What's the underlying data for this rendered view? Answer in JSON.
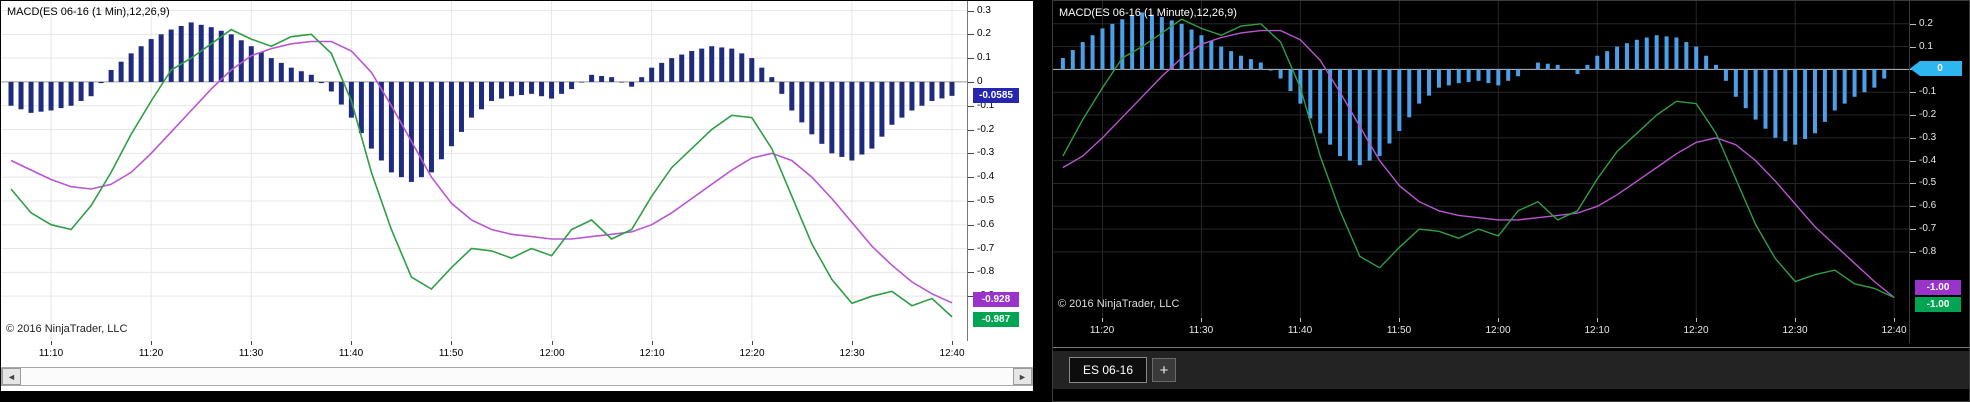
{
  "chart_data": [
    {
      "type": "bar",
      "subtype": "macd-indicator",
      "title": "MACD(ES 06-16 (1 Min),12,26,9)",
      "copyright": "© 2016 NinjaTrader, LLC",
      "theme": "light",
      "x": [
        "11:06",
        "11:08",
        "11:10",
        "11:12",
        "11:14",
        "11:16",
        "11:18",
        "11:20",
        "11:22",
        "11:24",
        "11:26",
        "11:28",
        "11:30",
        "11:32",
        "11:34",
        "11:36",
        "11:38",
        "11:40",
        "11:42",
        "11:44",
        "11:46",
        "11:48",
        "11:50",
        "11:52",
        "11:54",
        "11:56",
        "11:58",
        "12:00",
        "12:02",
        "12:04",
        "12:06",
        "12:08",
        "12:10",
        "12:12",
        "12:14",
        "12:16",
        "12:18",
        "12:20",
        "12:22",
        "12:24",
        "12:26",
        "12:28",
        "12:30",
        "12:32",
        "12:34",
        "12:36",
        "12:38",
        "12:40"
      ],
      "histogram": [
        -0.1,
        -0.13,
        -0.12,
        -0.1,
        -0.06,
        0.05,
        0.12,
        0.18,
        0.22,
        0.25,
        0.23,
        0.2,
        0.15,
        0.1,
        0.06,
        0.03,
        -0.04,
        -0.15,
        -0.28,
        -0.38,
        -0.42,
        -0.38,
        -0.27,
        -0.15,
        -0.08,
        -0.06,
        -0.05,
        -0.07,
        -0.03,
        0.03,
        0.02,
        -0.02,
        0.06,
        0.1,
        0.13,
        0.15,
        0.14,
        0.1,
        0.02,
        -0.12,
        -0.22,
        -0.3,
        -0.33,
        -0.28,
        -0.18,
        -0.12,
        -0.08,
        -0.0585
      ],
      "histogram_color": "#1f2b7d",
      "series": [
        {
          "name": "MACD",
          "color": "#2f9e44",
          "values": [
            -0.45,
            -0.55,
            -0.6,
            -0.62,
            -0.52,
            -0.38,
            -0.22,
            -0.08,
            0.05,
            0.1,
            0.16,
            0.22,
            0.18,
            0.15,
            0.19,
            0.2,
            0.12,
            -0.08,
            -0.38,
            -0.62,
            -0.82,
            -0.87,
            -0.78,
            -0.7,
            -0.71,
            -0.74,
            -0.7,
            -0.73,
            -0.62,
            -0.58,
            -0.66,
            -0.62,
            -0.48,
            -0.36,
            -0.28,
            -0.2,
            -0.14,
            -0.15,
            -0.28,
            -0.48,
            -0.68,
            -0.83,
            -0.93,
            -0.9,
            -0.88,
            -0.94,
            -0.91,
            -0.987
          ]
        },
        {
          "name": "Avg",
          "color": "#ba55d3",
          "values": [
            -0.33,
            -0.37,
            -0.41,
            -0.44,
            -0.45,
            -0.43,
            -0.38,
            -0.3,
            -0.21,
            -0.12,
            -0.03,
            0.05,
            0.11,
            0.14,
            0.16,
            0.17,
            0.17,
            0.13,
            0.04,
            -0.1,
            -0.25,
            -0.4,
            -0.51,
            -0.58,
            -0.62,
            -0.64,
            -0.65,
            -0.66,
            -0.66,
            -0.65,
            -0.64,
            -0.63,
            -0.6,
            -0.55,
            -0.49,
            -0.43,
            -0.37,
            -0.32,
            -0.3,
            -0.33,
            -0.4,
            -0.49,
            -0.59,
            -0.69,
            -0.77,
            -0.84,
            -0.89,
            -0.928
          ]
        }
      ],
      "yticks": [
        "0.3",
        "0.2",
        "0.1",
        "0",
        "-0.1",
        "-0.2",
        "-0.3",
        "-0.4",
        "-0.5",
        "-0.6",
        "-0.7",
        "-0.8",
        "-0.9"
      ],
      "xticks": [
        "11:10",
        "11:20",
        "11:30",
        "11:40",
        "11:50",
        "12:00",
        "12:10",
        "12:20",
        "12:30",
        "12:40"
      ],
      "ylim": [
        -1.08,
        0.34
      ],
      "xlim_minutes": [
        665,
        761.5
      ],
      "badges": [
        {
          "label": "-0.0585",
          "value": -0.0585,
          "color": "#2626b0"
        },
        {
          "label": "-0.928",
          "value": -0.928,
          "color": "#9933cc"
        },
        {
          "label": "-0.987",
          "value": -0.987,
          "color": "#00a551"
        }
      ]
    },
    {
      "type": "bar",
      "subtype": "macd-indicator",
      "title": "MACD(ES 06-16 (1 Minute),12,26,9)",
      "copyright": "© 2016 NinjaTrader, LLC",
      "theme": "dark",
      "x": [
        "11:16",
        "11:18",
        "11:20",
        "11:22",
        "11:24",
        "11:26",
        "11:28",
        "11:30",
        "11:32",
        "11:34",
        "11:36",
        "11:38",
        "11:40",
        "11:42",
        "11:44",
        "11:46",
        "11:48",
        "11:50",
        "11:52",
        "11:54",
        "11:56",
        "11:58",
        "12:00",
        "12:02",
        "12:04",
        "12:06",
        "12:08",
        "12:10",
        "12:12",
        "12:14",
        "12:16",
        "12:18",
        "12:20",
        "12:22",
        "12:24",
        "12:26",
        "12:28",
        "12:30",
        "12:32",
        "12:34",
        "12:36",
        "12:38",
        "12:40"
      ],
      "histogram": [
        0.05,
        0.12,
        0.18,
        0.22,
        0.25,
        0.23,
        0.2,
        0.15,
        0.1,
        0.06,
        0.03,
        -0.04,
        -0.15,
        -0.28,
        -0.38,
        -0.42,
        -0.38,
        -0.27,
        -0.15,
        -0.08,
        -0.06,
        -0.05,
        -0.07,
        -0.03,
        0.03,
        0.02,
        -0.02,
        0.06,
        0.1,
        0.13,
        0.15,
        0.14,
        0.1,
        0.02,
        -0.12,
        -0.22,
        -0.3,
        -0.33,
        -0.28,
        -0.18,
        -0.12,
        -0.08,
        0.0
      ],
      "histogram_color": "#4d9fe8",
      "series": [
        {
          "name": "MACD",
          "color": "#2f9e44",
          "values": [
            -0.38,
            -0.22,
            -0.08,
            0.05,
            0.1,
            0.16,
            0.22,
            0.18,
            0.15,
            0.19,
            0.2,
            0.12,
            -0.08,
            -0.38,
            -0.62,
            -0.82,
            -0.87,
            -0.78,
            -0.7,
            -0.71,
            -0.74,
            -0.7,
            -0.73,
            -0.62,
            -0.58,
            -0.66,
            -0.62,
            -0.48,
            -0.36,
            -0.28,
            -0.2,
            -0.14,
            -0.15,
            -0.28,
            -0.48,
            -0.68,
            -0.83,
            -0.93,
            -0.9,
            -0.88,
            -0.94,
            -0.96,
            -1.0
          ]
        },
        {
          "name": "Avg",
          "color": "#ba55d3",
          "values": [
            -0.43,
            -0.38,
            -0.3,
            -0.21,
            -0.12,
            -0.03,
            0.05,
            0.11,
            0.14,
            0.16,
            0.17,
            0.17,
            0.13,
            0.04,
            -0.1,
            -0.25,
            -0.4,
            -0.51,
            -0.58,
            -0.62,
            -0.64,
            -0.65,
            -0.66,
            -0.66,
            -0.65,
            -0.64,
            -0.63,
            -0.6,
            -0.55,
            -0.49,
            -0.43,
            -0.37,
            -0.32,
            -0.3,
            -0.33,
            -0.4,
            -0.49,
            -0.59,
            -0.69,
            -0.77,
            -0.85,
            -0.93,
            -1.0
          ]
        }
      ],
      "yticks": [
        "0.2",
        "0.1",
        "0",
        "-0.1",
        "-0.2",
        "-0.3",
        "-0.4",
        "-0.5",
        "-0.6",
        "-0.7",
        "-0.8"
      ],
      "xticks": [
        "11:20",
        "11:30",
        "11:40",
        "11:50",
        "12:00",
        "12:10",
        "12:20",
        "12:30",
        "12:40"
      ],
      "ylim": [
        -1.09,
        0.3
      ],
      "xlim_minutes": [
        675,
        761.5
      ],
      "badges": [
        {
          "label": "0",
          "value": 0,
          "color": "#2eb6f0",
          "arrow": true
        },
        {
          "label": "-1.00",
          "value": -1.0,
          "color": "#9933cc"
        },
        {
          "label": "-1.00",
          "value": -1.0,
          "color": "#00a551"
        }
      ]
    }
  ],
  "ui": {
    "scrollbar": {
      "left_arrow": "◄",
      "right_arrow": "►"
    },
    "tab_bar": {
      "tab_label": "ES 06-16",
      "add_label": "+"
    }
  }
}
